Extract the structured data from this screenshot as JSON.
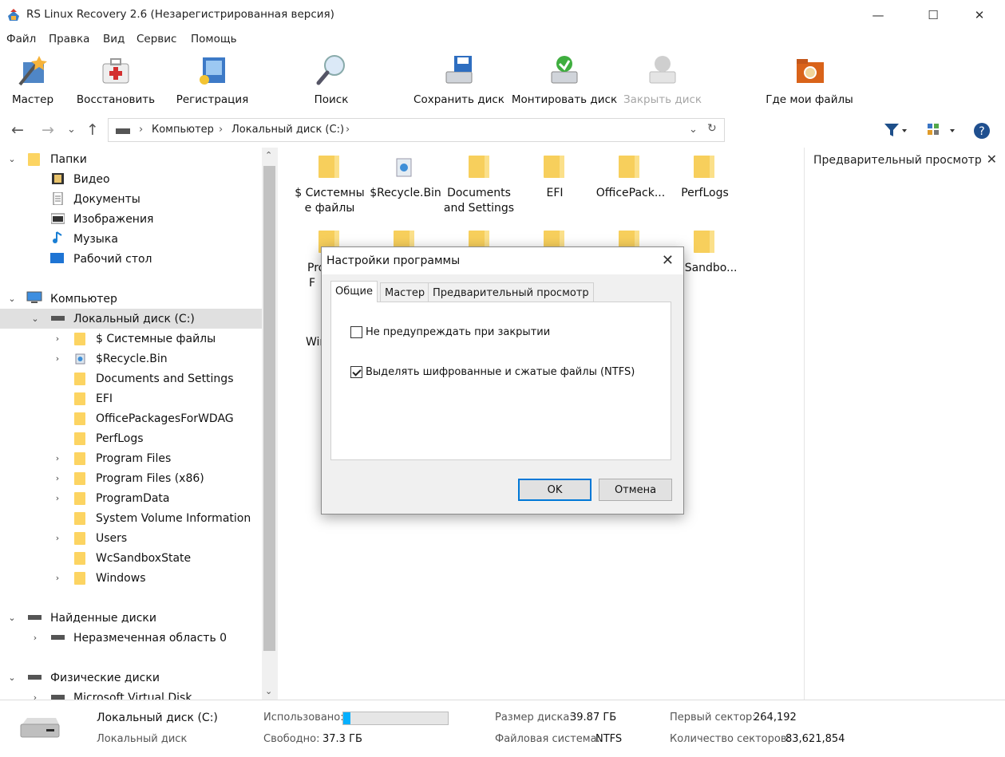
{
  "window": {
    "title": "RS Linux Recovery 2.6 (Незарегистрированная версия)",
    "minimize": "—",
    "maximize": "☐",
    "close": "✕"
  },
  "menu": [
    "Файл",
    "Правка",
    "Вид",
    "Сервис",
    "Помощь"
  ],
  "toolbar": {
    "wizard": "Мастер",
    "restore": "Восстановить",
    "register": "Регистрация",
    "search": "Поиск",
    "save_disk": "Сохранить диск",
    "mount_disk": "Монтировать диск",
    "close_disk": "Закрыть диск",
    "where_files": "Где мои файлы"
  },
  "nav": {
    "back": "←",
    "forward": "→",
    "recent": "⌄",
    "up": "↑",
    "refresh": "↻",
    "dropdown": "⌄"
  },
  "breadcrumb": [
    "Компьютер",
    "Локальный диск (C:)"
  ],
  "tree": {
    "folders_header": "Папки",
    "folders": [
      "Видео",
      "Документы",
      "Изображения",
      "Музыка",
      "Рабочий стол"
    ],
    "computer": "Компьютер",
    "local_disk": "Локальный диск (C:)",
    "disk_items": [
      "$ Системные файлы",
      "$Recycle.Bin",
      "Documents and Settings",
      "EFI",
      "OfficePackagesForWDAG",
      "PerfLogs",
      "Program Files",
      "Program Files (x86)",
      "ProgramData",
      "System Volume Information",
      "Users",
      "WcSandboxState",
      "Windows"
    ],
    "found_disks": "Найденные диски",
    "unallocated": "Неразмеченная область 0",
    "physical_disks": "Физические диски",
    "virtual_disk": "Microsoft Virtual Disk"
  },
  "content": {
    "row1": [
      {
        "line1": "$ Системны",
        "line2": "е файлы"
      },
      {
        "line1": "$Recycle.Bin",
        "line2": ""
      },
      {
        "line1": "Documents",
        "line2": "and Settings"
      },
      {
        "line1": "EFI",
        "line2": ""
      },
      {
        "line1": "OfficePack...",
        "line2": ""
      },
      {
        "line1": "PerfLogs",
        "line2": ""
      }
    ],
    "row2_partial": {
      "left1": "Pro",
      "left2": "F",
      "right": "cSandbo..."
    },
    "row3_partial": "Win"
  },
  "preview": {
    "title": "Предварительный просмотр",
    "close": "✕"
  },
  "status": {
    "disk_name": "Локальный диск (C:)",
    "disk_type": "Локальный диск",
    "used_label": "Использовано:",
    "used_fraction": 0.065,
    "free_label": "Свободно:",
    "free_value": "37.3 ГБ",
    "size_label": "Размер диска:",
    "size_value": "39.87 ГБ",
    "fs_label": "Файловая система:",
    "fs_value": "NTFS",
    "first_sector_label": "Первый сектор:",
    "first_sector_value": "264,192",
    "sector_count_label": "Количество секторов:",
    "sector_count_value": "83,621,854"
  },
  "dialog": {
    "title": "Настройки программы",
    "close": "✕",
    "tabs": [
      "Общие",
      "Мастер",
      "Предварительный просмотр"
    ],
    "options": [
      {
        "label": "Не предупреждать при закрытии",
        "checked": false
      },
      {
        "label": "Выделять шифрованные и сжатые файлы (NTFS)",
        "checked": true
      }
    ],
    "ok": "OK",
    "cancel": "Отмена"
  },
  "colors": {
    "accent": "#0078d7",
    "folder": "#f7cf5c",
    "selected": "#e0e0e0",
    "usage": "#06b0ff"
  }
}
